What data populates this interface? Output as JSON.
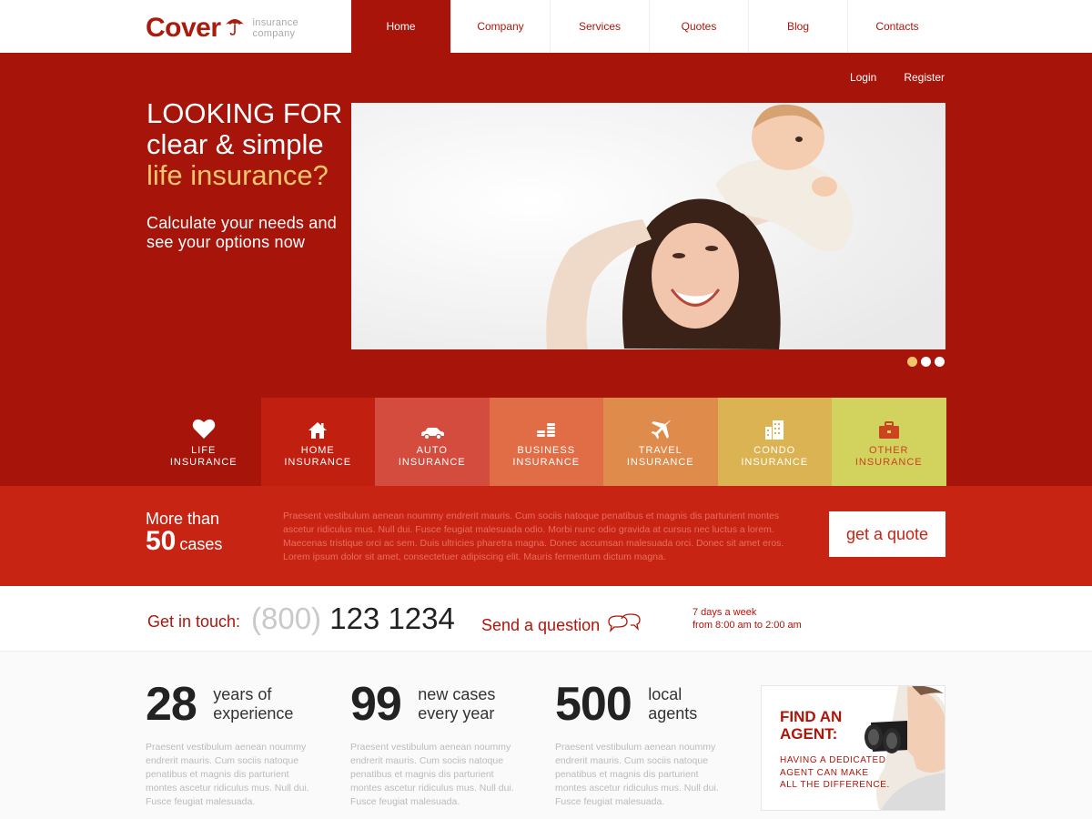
{
  "brand": {
    "name": "Cover",
    "tagline_line1": "insurance",
    "tagline_line2": "company"
  },
  "nav": [
    {
      "label": "Home",
      "active": true
    },
    {
      "label": "Company"
    },
    {
      "label": "Services"
    },
    {
      "label": "Quotes"
    },
    {
      "label": "Blog"
    },
    {
      "label": "Contacts"
    }
  ],
  "auth": {
    "login": "Login",
    "register": "Register"
  },
  "hero": {
    "line1": "LOOKING FOR",
    "line2": "clear & simple",
    "line3": "life insurance?",
    "sub": "Calculate your needs and see your options now",
    "slide_count": 3,
    "active_slide": 1
  },
  "tiles": [
    {
      "line1": "LIFE",
      "line2": "INSURANCE",
      "icon": "heart-icon",
      "bg": "#a7140a"
    },
    {
      "line1": "HOME",
      "line2": "INSURANCE",
      "icon": "house-icon",
      "bg": "#c11f10"
    },
    {
      "line1": "AUTO",
      "line2": "INSURANCE",
      "icon": "car-icon",
      "bg": "#d44c3d"
    },
    {
      "line1": "BUSINESS",
      "line2": "INSURANCE",
      "icon": "coins-icon",
      "bg": "#e06d45"
    },
    {
      "line1": "TRAVEL",
      "line2": "INSURANCE",
      "icon": "airplane-icon",
      "bg": "#df8b4b"
    },
    {
      "line1": "CONDO",
      "line2": "INSURANCE",
      "icon": "building-icon",
      "bg": "#dcb352"
    },
    {
      "line1": "OTHER",
      "line2": "INSURANCE",
      "icon": "briefcase-icon",
      "bg": "#d2d25f"
    }
  ],
  "band": {
    "more_than": "More than",
    "count": "50",
    "cases": "cases",
    "text": "Praesent vestibulum aenean noummy endrerit mauris. Cum sociis natoque penatibus et magnis dis parturient montes ascetur ridiculus mus. Null dui. Fusce feugiat malesuada odio. Morbi nunc odio gravida at cursus nec luctus a lorem. Maecenas tristique orci ac sem. Duis ultricies pharetra magna. Donec accumsan malesuada orci. Donec sit amet eros. Lorem ipsum dolor sit amet, consectetuer adipiscing elit. Mauris fermentum dictum magna.",
    "quote_button": "get a quote"
  },
  "contact": {
    "get_in_touch": "Get in touch:",
    "phone_code": "(800)",
    "phone_number": "123 1234",
    "send_question": "Send a question",
    "hours_line1": "7 days a week",
    "hours_line2": "from 8:00 am to 2:00 am"
  },
  "stats": [
    {
      "number": "28",
      "label_line1": "years of",
      "label_line2": "experience",
      "text": "Praesent vestibulum aenean noummy endrerit mauris. Cum sociis natoque penatibus et magnis dis parturient montes ascetur ridiculus mus. Null dui. Fusce feugiat malesuada."
    },
    {
      "number": "99",
      "label_line1": "new cases",
      "label_line2": "every year",
      "text": "Praesent vestibulum aenean noummy endrerit mauris. Cum sociis natoque penatibus et magnis dis parturient montes ascetur ridiculus mus. Null dui. Fusce feugiat malesuada."
    },
    {
      "number": "500",
      "label_line1": "local",
      "label_line2": "agents",
      "text": "Praesent vestibulum aenean noummy endrerit mauris. Cum sociis natoque penatibus et magnis dis parturient montes ascetur ridiculus mus. Null dui. Fusce feugiat malesuada."
    }
  ],
  "agent": {
    "title_line1": "FIND AN",
    "title_line2": "AGENT:",
    "text_line1": "HAVING A DEDICATED",
    "text_line2": "AGENT CAN MAKE",
    "text_line3": "ALL THE DIFFERENCE."
  },
  "colors": {
    "brand_red": "#a7140a",
    "band_red": "#c72413",
    "accent_gold": "#f2c46b"
  }
}
